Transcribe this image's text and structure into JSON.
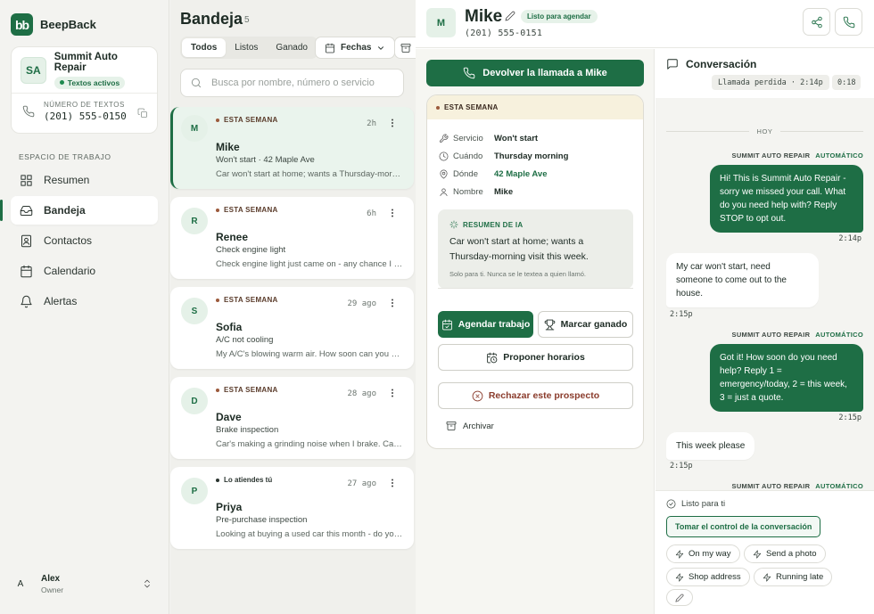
{
  "app": {
    "logo_mark": "bb",
    "name": "BeepBack"
  },
  "business": {
    "initials": "SA",
    "name": "Summit Auto Repair",
    "status": "Textos activos",
    "phone_label": "NÚMERO DE TEXTOS",
    "phone": "(201) 555-0150"
  },
  "sidebar": {
    "section_label": "ESPACIO DE TRABAJO",
    "items": [
      {
        "label": "Resumen",
        "icon": "grid-icon"
      },
      {
        "label": "Bandeja",
        "icon": "inbox-icon",
        "active": true
      },
      {
        "label": "Contactos",
        "icon": "contacts-icon"
      },
      {
        "label": "Calendario",
        "icon": "calendar-icon"
      },
      {
        "label": "Alertas",
        "icon": "bell-icon"
      }
    ],
    "user": {
      "initial": "A",
      "name": "Alex",
      "role": "Owner"
    }
  },
  "inbox": {
    "title": "Bandeja",
    "count": "5",
    "tabs": [
      "Todos",
      "Listos",
      "Ganado"
    ],
    "active_tab": "Todos",
    "dates_button": "Fechas",
    "search_placeholder": "Busca por nombre, número o servicio",
    "cards": [
      {
        "initial": "M",
        "tag": "ESTA SEMANA",
        "time": "2h",
        "name": "Mike",
        "sub": "Won't start · 42 Maple Ave",
        "preview": "Car won't start at home; wants a Thursday-morn…",
        "active": true
      },
      {
        "initial": "R",
        "tag": "ESTA SEMANA",
        "time": "6h",
        "name": "Renee",
        "sub": "Check engine light",
        "preview": "Check engine light just came on - any chance I …"
      },
      {
        "initial": "S",
        "tag": "ESTA SEMANA",
        "time": "29 ago",
        "name": "Sofia",
        "sub": "A/C not cooling",
        "preview": "My A/C's blowing warm air. How soon can you …"
      },
      {
        "initial": "D",
        "tag": "ESTA SEMANA",
        "time": "28 ago",
        "name": "Dave",
        "sub": "Brake inspection",
        "preview": "Car's making a grinding noise when I brake. Ca…"
      },
      {
        "initial": "P",
        "tag": "Lo atiendes tú",
        "time": "27 ago",
        "name": "Priya",
        "sub": "Pre-purchase inspection",
        "preview": "Looking at buying a used car this month - do yo…"
      }
    ]
  },
  "detail": {
    "initial": "M",
    "name": "Mike",
    "status": "Listo para agendar",
    "phone": "(201) 555-0151",
    "callback_label": "Devolver la llamada a Mike",
    "tag": "ESTA SEMANA",
    "fields": [
      {
        "label": "Servicio",
        "value": "Won't start",
        "icon": "wrench-icon"
      },
      {
        "label": "Cuándo",
        "value": "Thursday morning",
        "icon": "clock-icon"
      },
      {
        "label": "Dónde",
        "value": "42 Maple Ave",
        "icon": "pin-icon",
        "accent": true
      },
      {
        "label": "Nombre",
        "value": "Mike",
        "icon": "person-icon"
      }
    ],
    "ai": {
      "label": "RESUMEN DE IA",
      "text": "Car won't start at home; wants a Thursday-morning visit this week.",
      "note": "Solo para ti. Nunca se le textea a quien llamó."
    },
    "actions": {
      "schedule": "Agendar trabajo",
      "won": "Marcar ganado",
      "propose": "Proponer horarios",
      "reject": "Rechazar este prospecto",
      "archive": "Archivar"
    }
  },
  "conversation": {
    "title": "Conversación",
    "missed_call": "Llamada perdida · 2:14p",
    "duration": "0:18",
    "day": "HOY",
    "sender": "SUMMIT AUTO REPAIR",
    "auto_label": "AUTOMÁTICO",
    "messages": [
      {
        "text": "Hi! This is Summit Auto Repair - sorry we missed your call. What do you need help with? Reply STOP to opt out.",
        "time": "2:14p"
      },
      {
        "text": "My car won't start, need someone to come out to the house.",
        "time": "2:15p"
      },
      {
        "text": "Got it! How soon do you need help? Reply 1 = emergency/today, 2 = this week, 3 = just a quote.",
        "time": "2:15p"
      },
      {
        "text": "This week please",
        "time": "2:15p"
      }
    ],
    "ready_label": "Listo para ti",
    "takeover_label": "Tomar el control de la conversación",
    "quick_replies": [
      "On my way",
      "Send a photo",
      "Shop address",
      "Running late"
    ]
  },
  "colors": {
    "brand": "#1e6e45",
    "tag_dot": "#9c5a3c",
    "week_banner": "#f7f1dd"
  }
}
